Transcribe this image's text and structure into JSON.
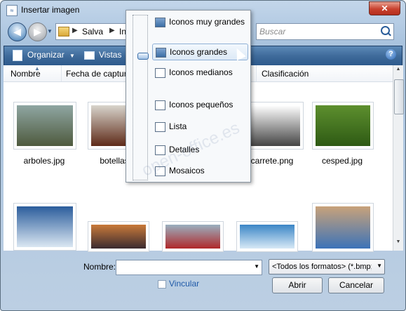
{
  "window": {
    "title": "Insertar imagen",
    "close_label": "✕"
  },
  "nav": {
    "back_glyph": "◀",
    "forward_glyph": "▶",
    "dropdown_glyph": "▼",
    "breadcrumb": [
      "Salva",
      "In"
    ],
    "sep_glyph": "▶",
    "search_placeholder": "Buscar"
  },
  "toolbar": {
    "organize_label": "Organizar",
    "organize_arrow": "▼",
    "views_label": "Vistas",
    "help_glyph": "?"
  },
  "columns": [
    "Nombre",
    "Fecha de captur",
    "Clasificación"
  ],
  "files": [
    {
      "name": "arboles.jpg",
      "colors": [
        "#8fa6a2",
        "#4e5a3e"
      ]
    },
    {
      "name": "botellas",
      "colors": [
        "#d8d4cc",
        "#5e2a18"
      ]
    },
    {
      "name": "carrete.png",
      "colors": [
        "#ffffff",
        "#444444"
      ]
    },
    {
      "name": "cesped.jpg",
      "colors": [
        "#5d8f2e",
        "#2e5a14"
      ]
    },
    {
      "name": "",
      "colors": [
        "#2b5d9c",
        "#dbe7f2"
      ]
    },
    {
      "name": "",
      "colors": [
        "#c97a3a",
        "#3a2a30"
      ]
    },
    {
      "name": "",
      "colors": [
        "#9ab0c0",
        "#b0282a"
      ]
    },
    {
      "name": "",
      "colors": [
        "#3b86c6",
        "#d7e9f6"
      ]
    },
    {
      "name": "",
      "colors": [
        "#c8a27a",
        "#3c73b8"
      ]
    }
  ],
  "views_menu": [
    "Iconos muy grandes",
    "Iconos grandes",
    "Iconos medianos",
    "Iconos pequeños",
    "Lista",
    "Detalles",
    "Mosaicos"
  ],
  "watermark": "open-office.es",
  "bottom": {
    "filename_label": "Nombre:",
    "filename_value": "",
    "filter_value": "<Todos los formatos> (*.bmp;*",
    "link_label": "Vincular",
    "open_label": "Abrir",
    "cancel_label": "Cancelar",
    "dd_glyph": "▼"
  },
  "scroll": {
    "up_glyph": "▲",
    "down_glyph": "▼"
  }
}
